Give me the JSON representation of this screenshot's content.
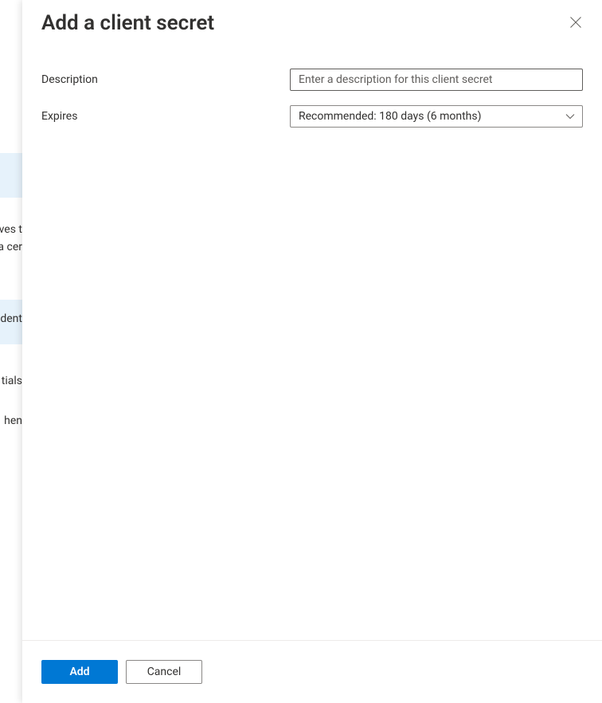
{
  "panel": {
    "title": "Add a client secret"
  },
  "form": {
    "description": {
      "label": "Description",
      "placeholder": "Enter a description for this client secret",
      "value": ""
    },
    "expires": {
      "label": "Expires",
      "selected": "Recommended: 180 days (6 months)"
    }
  },
  "footer": {
    "add_label": "Add",
    "cancel_label": "Cancel"
  },
  "bg": {
    "text1": "ves t",
    "text2": "a cer",
    "text3": "dent",
    "text4": "tials",
    "text5": "hen"
  }
}
